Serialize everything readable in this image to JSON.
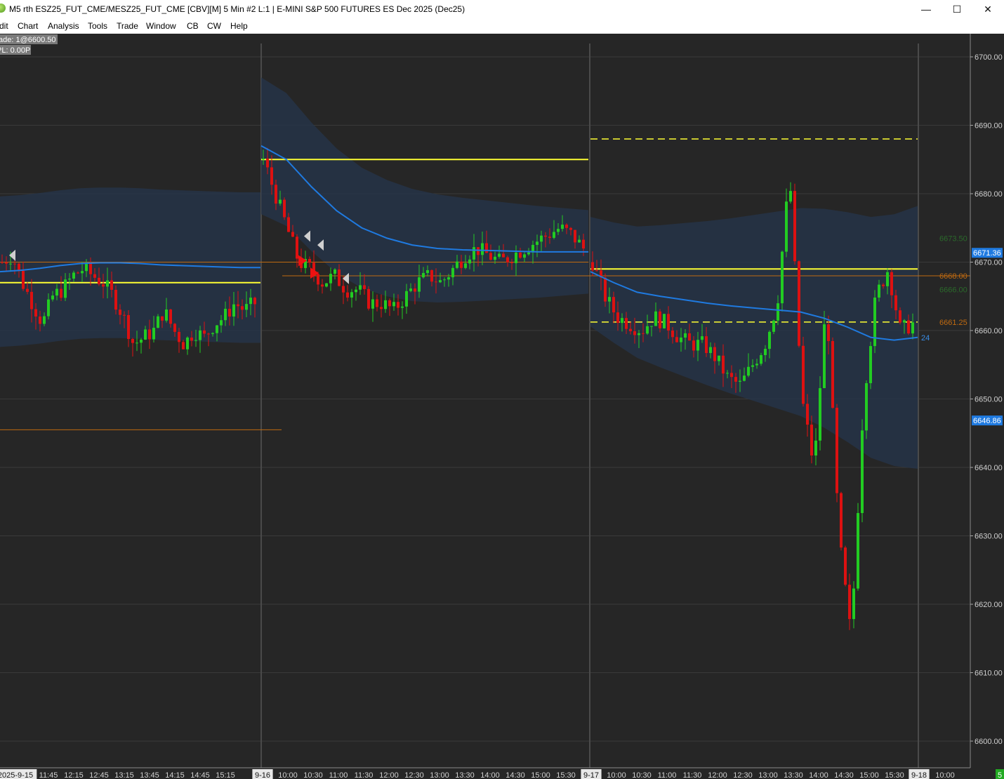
{
  "window": {
    "title": "M5 rth ESZ25_FUT_CME/MESZ25_FUT_CME [CBV][M]  5 Min  #2 L:1 | E-MINI S&P 500 FUTURES ES Dec 2025 (Dec25)",
    "minimize": "—",
    "maximize": "☐",
    "close": "✕"
  },
  "menu": [
    "dit",
    "Chart",
    "Analysis",
    "Tools",
    "Trade",
    "Window",
    "CB",
    "CW",
    "Help"
  ],
  "overlay": {
    "trade": "ade: 1@6600.50",
    "pl": "PL: 0.00P"
  },
  "colors": {
    "background": "#262626",
    "up": "#22cc22",
    "down": "#dd1111",
    "vwap": "#1f7ae0",
    "level": "#ffff33",
    "orange": "#c06a10",
    "grid": "#3a3a3a"
  },
  "chart_data": {
    "type": "candlestick",
    "symbol": "ESZ25",
    "interval": "5 Min",
    "ylim": [
      6597,
      6705
    ],
    "y_ticks": [
      "6700.00",
      "6690.00",
      "6680.00",
      "6670.00",
      "6660.00",
      "6650.00",
      "6640.00",
      "6630.00",
      "6620.00",
      "6610.00",
      "6600.00"
    ],
    "x_labels": [
      "2025-9-15",
      "11:45",
      "12:15",
      "12:45",
      "13:15",
      "13:45",
      "14:15",
      "14:45",
      "15:15",
      "9-16",
      "10:00",
      "10:30",
      "11:00",
      "11:30",
      "12:00",
      "12:30",
      "13:00",
      "13:30",
      "14:00",
      "14:30",
      "15:00",
      "15:30",
      "9-17",
      "10:00",
      "10:30",
      "11:00",
      "11:30",
      "12:00",
      "12:30",
      "13:00",
      "13:30",
      "14:00",
      "14:30",
      "15:00",
      "15:30",
      "9-18",
      "10:00"
    ],
    "x_label_highlight": [
      0,
      9,
      22,
      35
    ],
    "sessions": [
      {
        "label": "9-15",
        "start": 0,
        "end": 102,
        "hi": 6673.5,
        "lo": 6658.5,
        "closes": [
          6670,
          6671,
          6667,
          6664,
          6661,
          6665,
          6666,
          6668,
          6669,
          6668,
          6667,
          6665,
          6662,
          6658,
          6659,
          6660,
          6663,
          6660,
          6658,
          6660,
          6659,
          6661,
          6662,
          6664,
          6663,
          6664
        ],
        "vwap": [
          6668.6,
          6668.8,
          6669.1,
          6669.5,
          6669.8,
          6669.9,
          6669.9,
          6669.8,
          6669.6,
          6669.5,
          6669.4,
          6669.3,
          6669.2,
          6669.2
        ],
        "level": 6667.0
      },
      {
        "label": "9-16",
        "start": 102,
        "end": 130,
        "hi": 6685,
        "lo": 6662.5,
        "closes": [
          6685,
          6680,
          6675,
          6670,
          6669,
          6667,
          6668,
          6666,
          6666,
          6664,
          6664,
          6663,
          6665,
          6667,
          6668,
          6667,
          6669,
          6671,
          6672,
          6671,
          6670,
          6671,
          6672,
          6673,
          6674,
          6675,
          6674,
          6672
        ],
        "vwap": [
          6687,
          6685,
          6681,
          6677.5,
          6675,
          6673.5,
          6672.5,
          6672,
          6671.8,
          6671.7,
          6671.6,
          6671.5,
          6671.5,
          6671.5
        ],
        "level": 6685.0,
        "orange_line": 6668.0
      },
      {
        "label": "9-17",
        "start": 230,
        "end": 500,
        "hi": 6686,
        "lo": 6611.5,
        "closes": [
          6670,
          6665,
          6662,
          6661,
          6660,
          6662,
          6661,
          6659,
          6658,
          6658,
          6656,
          6653,
          6652,
          6655,
          6658,
          6664,
          6683,
          6650,
          6640,
          6665,
          6630,
          6615,
          6650,
          6665,
          6669,
          6660,
          6661
        ],
        "vwap": [
          6668.6,
          6667,
          6665.6,
          6665,
          6664.5,
          6664,
          6663.6,
          6663.3,
          6663,
          6662.7,
          6661.8,
          6660.5,
          6659,
          6658.6,
          6659
        ],
        "level": 6669.0,
        "dashed_yellow": [
          6688.0,
          6661.25
        ],
        "orange_line": 6668.0
      },
      {
        "label": "9-18",
        "start": 500,
        "end": 501,
        "hi": 6661,
        "lo": 6661,
        "closes": [],
        "vwap": [],
        "level": null
      }
    ],
    "price_labels": [
      {
        "text": "6671.36",
        "value": 6671.36,
        "bg": "#1f7ae0",
        "fg": "#ffffff"
      },
      {
        "text": "6668.00",
        "value": 6668.0,
        "bg": "none",
        "fg": "#c06a10"
      },
      {
        "text": "6661.25",
        "value": 6661.25,
        "bg": "none",
        "fg": "#c06a10"
      },
      {
        "text": "6646.86",
        "value": 6646.86,
        "bg": "#1f7ae0",
        "fg": "#ffffff"
      },
      {
        "text": "6673.50",
        "value": 6673.5,
        "bg": "none",
        "fg": "#2b6a2b"
      },
      {
        "text": "6666.00",
        "value": 6666.0,
        "bg": "none",
        "fg": "#2b6a2b"
      },
      {
        "text": "24",
        "value": 6659,
        "bg": "none",
        "fg": "#3a8ee8"
      }
    ],
    "status_badge": "5"
  }
}
